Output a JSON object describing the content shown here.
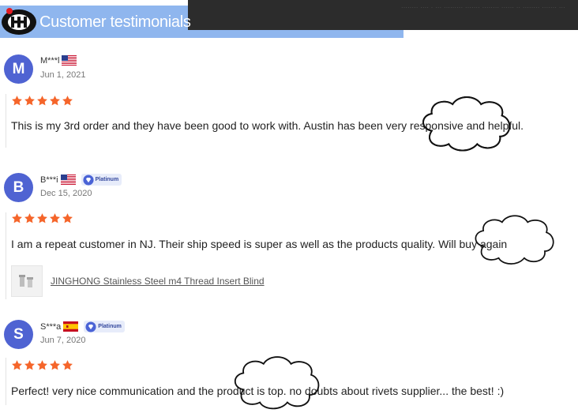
{
  "header": {
    "title": "Customer testimonials",
    "top_strip_text": "........ .... . ... ......... ....... ........ ...... .. ........ ....... ..."
  },
  "colors": {
    "header_blue": "#8fb6ee",
    "header_dark": "#2c2c2c",
    "avatar": "#4f63d2",
    "star": "#f5652a",
    "badge_bg": "#e7ecfa"
  },
  "reviews": [
    {
      "initial": "M",
      "name": "M***l",
      "country_flag": "us-flag",
      "badge": "",
      "date": "Jun 1, 2021",
      "rating": 5,
      "text": "This is my 3rd order and they have been good to work with. Austin has been very responsive and helpful."
    },
    {
      "initial": "B",
      "name": "B***i",
      "country_flag": "us-flag",
      "badge": "Platinum",
      "date": "Dec 15, 2020",
      "rating": 5,
      "text": "I am a repeat customer in NJ. Their ship speed is super as well as the products quality. Will buy again",
      "product": "JINGHONG Stainless Steel m4 Thread Insert Blind"
    },
    {
      "initial": "S",
      "name": "S***a",
      "country_flag": "es-flag",
      "badge": "Platinum",
      "date": "Jun 7, 2020",
      "rating": 5,
      "text": "Perfect! very nice communication and the product is top. no doubts about rivets supplier... the best! :)"
    }
  ]
}
